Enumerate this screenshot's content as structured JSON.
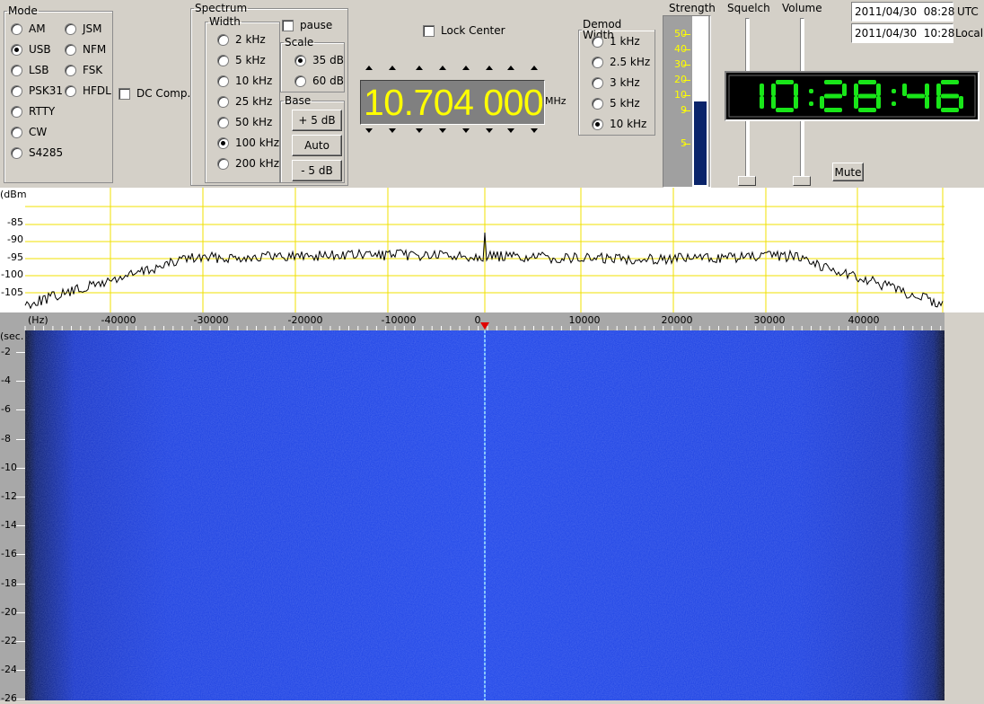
{
  "mode": {
    "legend": "Mode",
    "options": [
      {
        "label": "AM",
        "selected": false
      },
      {
        "label": "JSM",
        "selected": false
      },
      {
        "label": "USB",
        "selected": true
      },
      {
        "label": "NFM",
        "selected": false
      },
      {
        "label": "LSB",
        "selected": false
      },
      {
        "label": "FSK",
        "selected": false
      },
      {
        "label": "PSK31",
        "selected": false
      },
      {
        "label": "HFDL",
        "selected": false
      },
      {
        "label": "RTTY",
        "selected": false
      },
      {
        "label": "CW",
        "selected": false
      },
      {
        "label": "S4285",
        "selected": false
      }
    ]
  },
  "dc_comp": {
    "label": "DC Comp.",
    "checked": false
  },
  "spectrum": {
    "legend": "Spectrum",
    "width_legend": "Width",
    "widths": [
      {
        "label": "2 kHz",
        "selected": false
      },
      {
        "label": "5 kHz",
        "selected": false
      },
      {
        "label": "10 kHz",
        "selected": false
      },
      {
        "label": "25 kHz",
        "selected": false
      },
      {
        "label": "50 kHz",
        "selected": false
      },
      {
        "label": "100 kHz",
        "selected": true
      },
      {
        "label": "200 kHz",
        "selected": false
      }
    ],
    "pause": {
      "label": "pause",
      "checked": false
    },
    "scale_legend": "Scale",
    "scales": [
      {
        "label": "35 dB",
        "selected": true
      },
      {
        "label": "60 dB",
        "selected": false
      }
    ],
    "base_legend": "Base",
    "base_buttons": [
      "+ 5 dB",
      "Auto",
      "- 5 dB"
    ]
  },
  "lock_center": {
    "label": "Lock Center",
    "checked": false
  },
  "frequency": {
    "value": "10.704 000",
    "unit": "MHz"
  },
  "demod": {
    "legend": "Demod Width",
    "options": [
      {
        "label": "1 kHz",
        "selected": false
      },
      {
        "label": "2.5 kHz",
        "selected": false
      },
      {
        "label": "3 kHz",
        "selected": false
      },
      {
        "label": "5 kHz",
        "selected": false
      },
      {
        "label": "10 kHz",
        "selected": true
      }
    ]
  },
  "strength": {
    "label": "Strength",
    "scale": [
      "50",
      "40",
      "30",
      "20",
      "10",
      "9",
      "5"
    ],
    "level": 0.5
  },
  "squelch": {
    "label": "Squelch",
    "level": 0
  },
  "volume": {
    "label": "Volume",
    "level": 0
  },
  "time": {
    "utc": "2011/04/30  08:28",
    "utc_label": "UTC",
    "local": "2011/04/30  10:28",
    "local_label": "Local",
    "clock": "10:28:46"
  },
  "mute_label": "Mute",
  "spectrum_plot": {
    "y_unit": "(dBm",
    "y_ticks": [
      "-85",
      "-90",
      "-95",
      "-100",
      "-105"
    ],
    "x_unit": "(Hz)",
    "x_ticks": [
      "-40000",
      "-30000",
      "-20000",
      "-10000",
      "0",
      "10000",
      "20000",
      "30000",
      "40000"
    ]
  },
  "waterfall": {
    "y_unit": "(sec.",
    "y_ticks": [
      "-2",
      "-4",
      "-6",
      "-8",
      "-10",
      "-12",
      "-14",
      "-16",
      "-18",
      "-20",
      "-22",
      "-24",
      "-26"
    ]
  },
  "colors": {
    "freq_bg": "#808080",
    "freq_fg": "#ffff00",
    "clock_fg": "#19e619",
    "strength_bar": "#0a246a",
    "grid": "#f0e000",
    "waterfall": "#1a3ee0"
  }
}
